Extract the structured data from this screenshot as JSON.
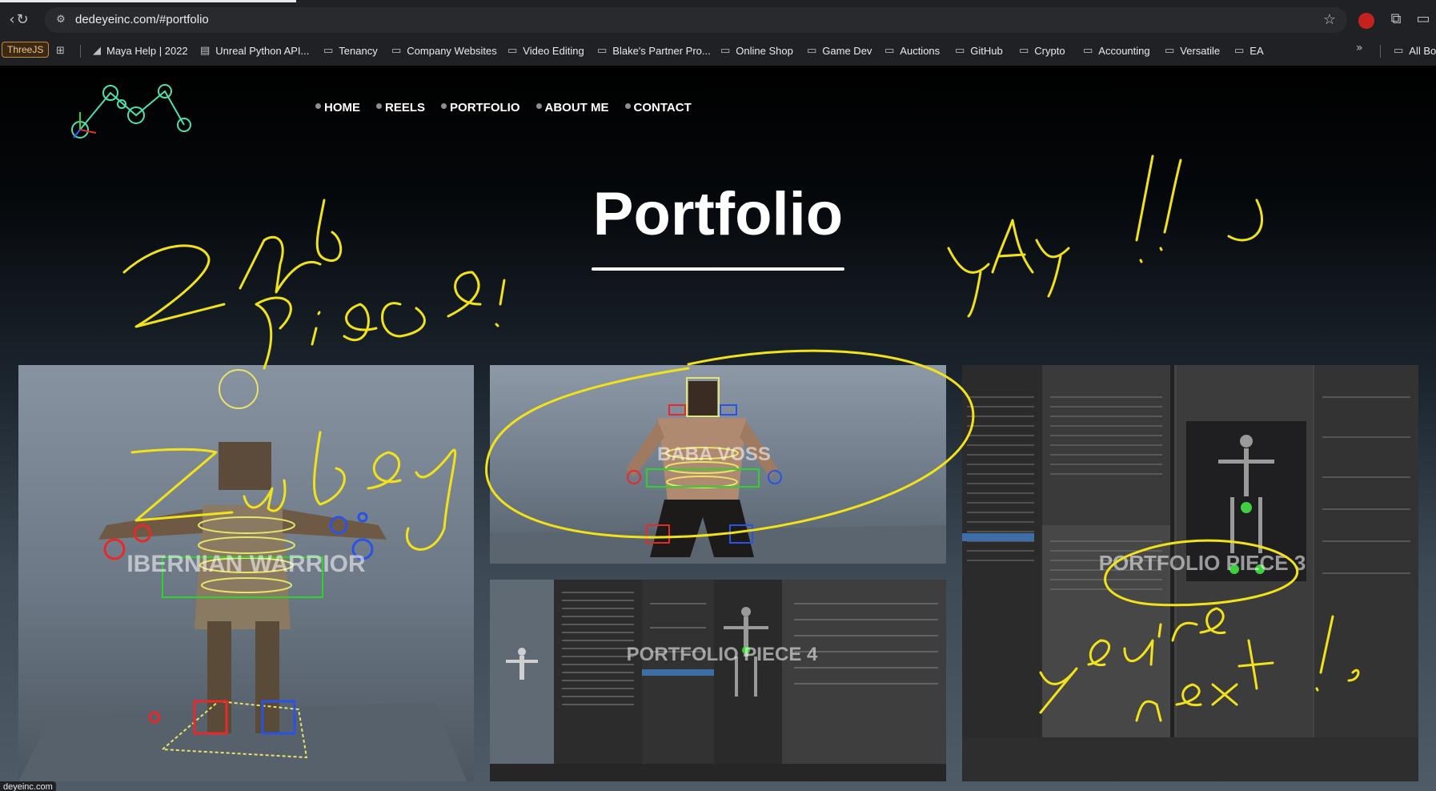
{
  "browser": {
    "url": "dedeyeinc.com/#portfolio",
    "status_url": "deyeinc.com",
    "bookmarks": [
      {
        "label": "ThreeJS"
      },
      {
        "label": "Maya Help | 2022",
        "icon": "maya-icon"
      },
      {
        "label": "Unreal Python API...",
        "icon": "doc-icon"
      },
      {
        "label": "Tenancy",
        "icon": "folder-icon"
      },
      {
        "label": "Company Websites",
        "icon": "folder-icon"
      },
      {
        "label": "Video Editing",
        "icon": "folder-icon"
      },
      {
        "label": "Blake's Partner Pro...",
        "icon": "folder-icon"
      },
      {
        "label": "Online Shop",
        "icon": "folder-icon"
      },
      {
        "label": "Game Dev",
        "icon": "folder-icon"
      },
      {
        "label": "Auctions",
        "icon": "folder-icon"
      },
      {
        "label": "GitHub",
        "icon": "folder-icon"
      },
      {
        "label": "Crypto",
        "icon": "folder-icon"
      },
      {
        "label": "Accounting",
        "icon": "folder-icon"
      },
      {
        "label": "Versatile",
        "icon": "folder-icon"
      },
      {
        "label": "EA",
        "icon": "folder-icon"
      },
      {
        "label": "All Bo",
        "icon": "folder-icon"
      }
    ]
  },
  "site": {
    "nav": [
      "HOME",
      "REELS",
      "PORTFOLIO",
      "ABOUT ME",
      "CONTACT"
    ],
    "title": "Portfolio",
    "tiles": {
      "t1": "IBERNIAN WARRIOR",
      "t2": "BABA VOSS",
      "t3": "PORTFOLIO PIECE 3",
      "t4": "PORTFOLIO PIECE 4"
    }
  },
  "annotations": {
    "color": "#f2e21a",
    "texts": [
      "2nd Piece!",
      "Zubey",
      "YAY!!",
      "you're next!"
    ]
  },
  "colors": {
    "chrome_bg": "#202124",
    "omnibox_bg": "#282a2d",
    "page_bg_bottom": "#4f5c68",
    "maya_viewport": "#6b7784"
  }
}
